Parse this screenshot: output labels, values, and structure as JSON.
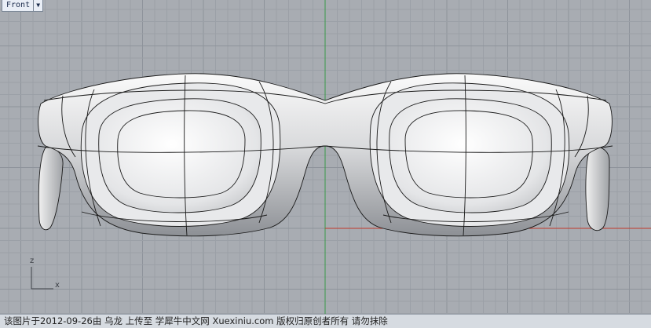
{
  "viewport": {
    "view_name": "Front",
    "view_menu_icon": "dropdown-triangle-icon",
    "background_color": "#a8acb2",
    "grid_color": "#9ba0a7",
    "grid_major_color": "#8e939b",
    "x_axis_color": "#c0392b",
    "z_axis_color": "#3a9a4a",
    "model": "eyeglasses-surface-model",
    "axis_widget": {
      "z_label": "z",
      "x_label": "x"
    }
  },
  "footer": {
    "watermark": "该图片于2012-09-26由 乌龙 上传至 学犀牛中文网 Xuexiniu.com 版权归原创者所有 请勿抹除"
  }
}
